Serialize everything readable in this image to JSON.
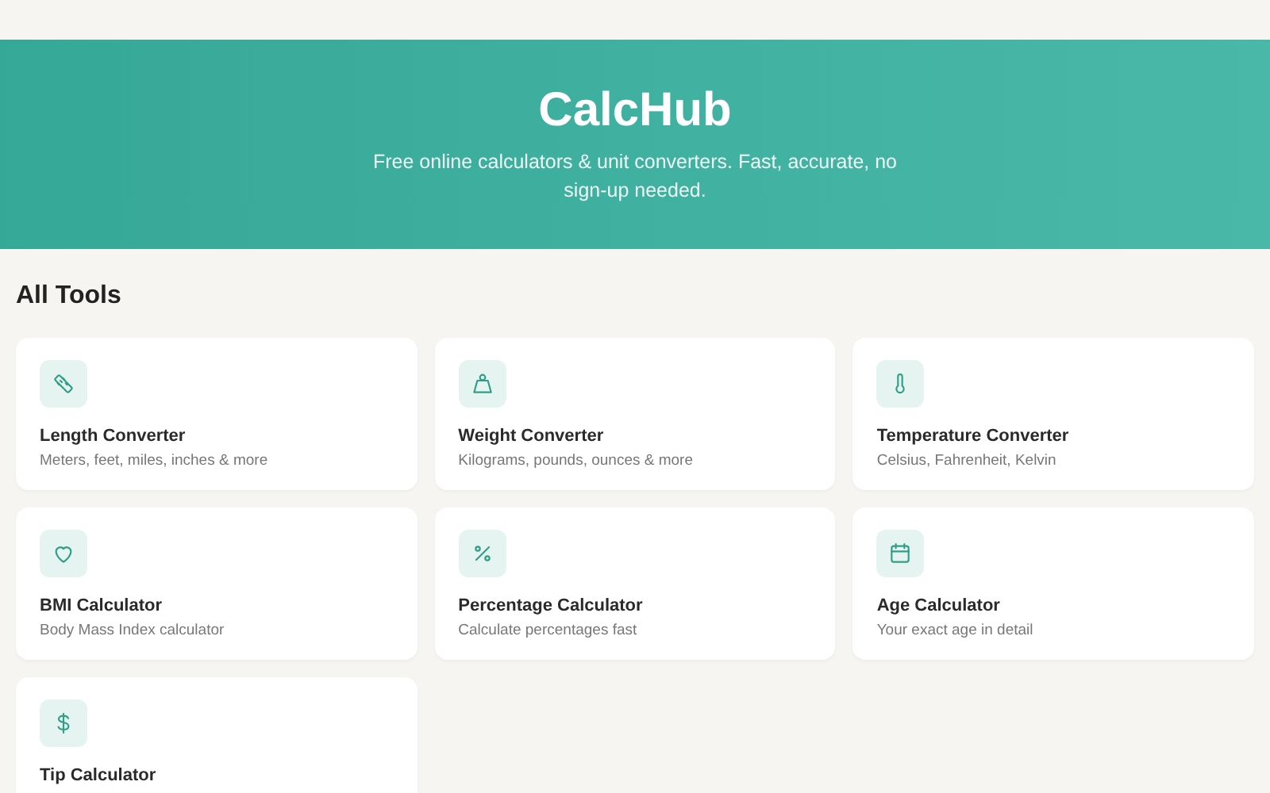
{
  "hero": {
    "title": "CalcHub",
    "subtitle": "Free online calculators & unit converters. Fast, accurate, no sign-up needed."
  },
  "section_title": "All Tools",
  "tools": [
    {
      "title": "Length Converter",
      "description": "Meters, feet, miles, inches & more"
    },
    {
      "title": "Weight Converter",
      "description": "Kilograms, pounds, ounces & more"
    },
    {
      "title": "Temperature Converter",
      "description": "Celsius, Fahrenheit, Kelvin"
    },
    {
      "title": "BMI Calculator",
      "description": "Body Mass Index calculator"
    },
    {
      "title": "Percentage Calculator",
      "description": "Calculate percentages fast"
    },
    {
      "title": "Age Calculator",
      "description": "Your exact age in detail"
    },
    {
      "title": "Tip Calculator"
    }
  ]
}
